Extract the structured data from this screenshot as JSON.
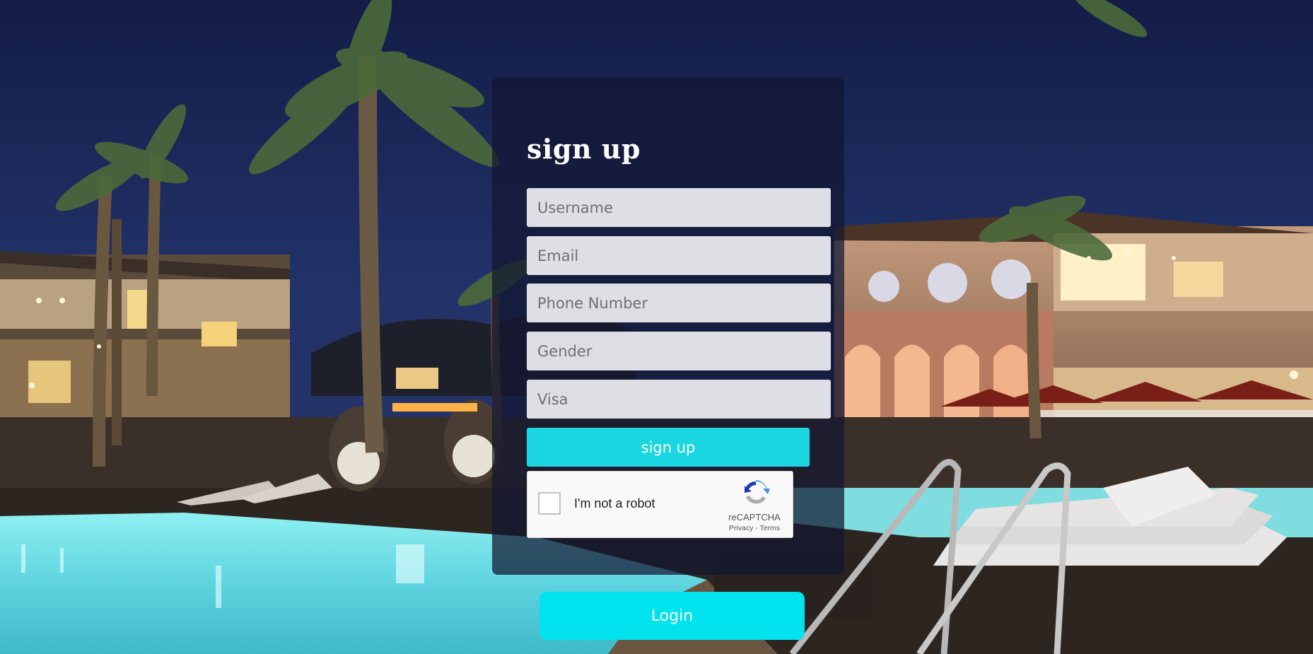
{
  "signup_form": {
    "title": "sign up",
    "fields": {
      "username_placeholder": "Username",
      "email_placeholder": "Email",
      "phone_placeholder": "Phone Number",
      "gender_placeholder": "Gender",
      "visa_placeholder": "Visa"
    },
    "submit_label": "sign up"
  },
  "recaptcha": {
    "label": "I'm not a robot",
    "brand": "reCAPTCHA",
    "privacy_link": "Privacy",
    "separator": "-",
    "terms_link": "Terms",
    "checked": false,
    "icon": "recaptcha-logo-icon"
  },
  "login": {
    "label": "Login"
  },
  "background": {
    "description_icon": "resort-pool-night-photo"
  },
  "colors": {
    "signup_button": "#19d6e0",
    "login_button": "#00e3ef",
    "panel": "#121630",
    "sky": "#1c2a5c",
    "pool": "#6fe3ea"
  }
}
